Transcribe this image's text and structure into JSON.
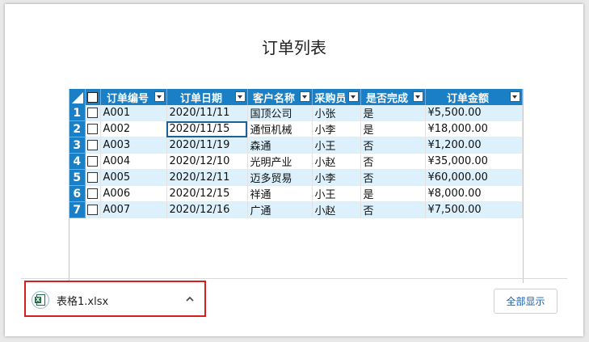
{
  "page": {
    "title": "订单列表"
  },
  "table": {
    "headers": [
      "订单编号",
      "订单日期",
      "客户名称",
      "采购员",
      "是否完成",
      "订单金额"
    ],
    "rows": [
      {
        "num": "1",
        "cells": [
          "A001",
          "2020/11/11",
          "国顶公司",
          "小张",
          "是",
          "¥5,500.00"
        ]
      },
      {
        "num": "2",
        "cells": [
          "A002",
          "2020/11/15",
          "通恒机械",
          "小李",
          "是",
          "¥18,000.00"
        ]
      },
      {
        "num": "3",
        "cells": [
          "A003",
          "2020/11/19",
          "森通",
          "小王",
          "否",
          "¥1,200.00"
        ]
      },
      {
        "num": "4",
        "cells": [
          "A004",
          "2020/12/10",
          "光明产业",
          "小赵",
          "否",
          "¥35,000.00"
        ]
      },
      {
        "num": "5",
        "cells": [
          "A005",
          "2020/12/11",
          "迈多贸易",
          "小李",
          "否",
          "¥60,000.00"
        ]
      },
      {
        "num": "6",
        "cells": [
          "A006",
          "2020/12/15",
          "祥通",
          "小王",
          "是",
          "¥8,000.00"
        ]
      },
      {
        "num": "7",
        "cells": [
          "A007",
          "2020/12/16",
          "广通",
          "小赵",
          "否",
          "¥7,500.00"
        ]
      }
    ]
  },
  "download": {
    "filename": "表格1.xlsx",
    "icon": "excel-file-icon"
  },
  "footer": {
    "show_all_label": "全部显示"
  },
  "colors": {
    "header_blue": "#1b7fc5",
    "row_stripe": "#dcf1fb",
    "highlight_red": "#d71d1d",
    "link_blue": "#1a5fb4"
  }
}
